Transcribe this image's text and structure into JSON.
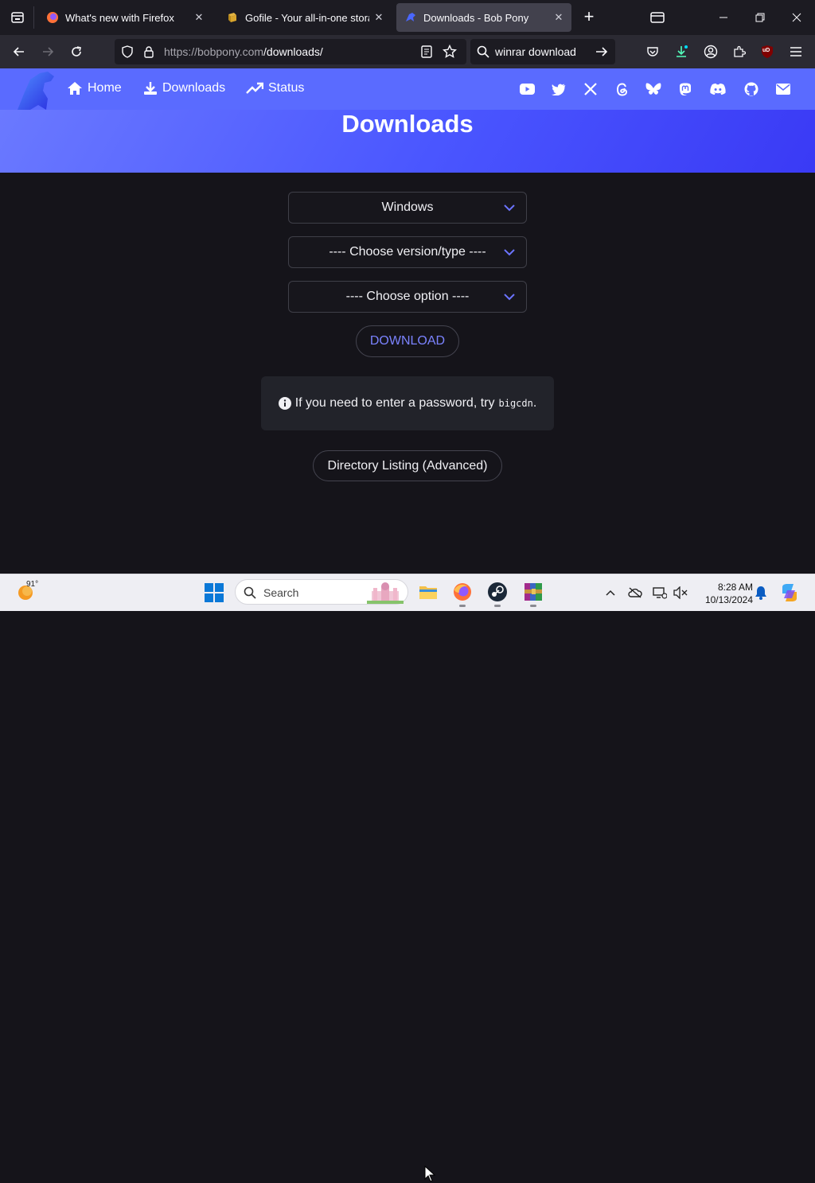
{
  "browser": {
    "tabs": [
      {
        "title": "What's new with Firefox"
      },
      {
        "title": "Gofile - Your all-in-one storage"
      },
      {
        "title": "Downloads - Bob Pony"
      }
    ],
    "url_host": "https://bobpony.com",
    "url_path": "/downloads/",
    "search_query": "winrar download",
    "ublock_label": "uD"
  },
  "site": {
    "nav": [
      {
        "label": "Home"
      },
      {
        "label": "Downloads"
      },
      {
        "label": "Status"
      }
    ],
    "social_icons": [
      "youtube-icon",
      "twitter-icon",
      "x-icon",
      "threads-icon",
      "bluesky-icon",
      "mastodon-icon",
      "discord-icon",
      "github-icon",
      "mail-icon"
    ],
    "page_title": "Downloads",
    "os_select": "Windows",
    "version_select": "---- Choose version/type ----",
    "option_select": "---- Choose option ----",
    "download_button": "DOWNLOAD",
    "notice_text": "If you need to enter a password, try",
    "notice_code": "bigcdn",
    "notice_period": ".",
    "directory_button": "Directory Listing (Advanced)",
    "accent_color": "#5a6bff"
  },
  "taskbar": {
    "temperature": "91°",
    "search_label": "Search",
    "time": "8:28 AM",
    "date": "10/13/2024"
  }
}
